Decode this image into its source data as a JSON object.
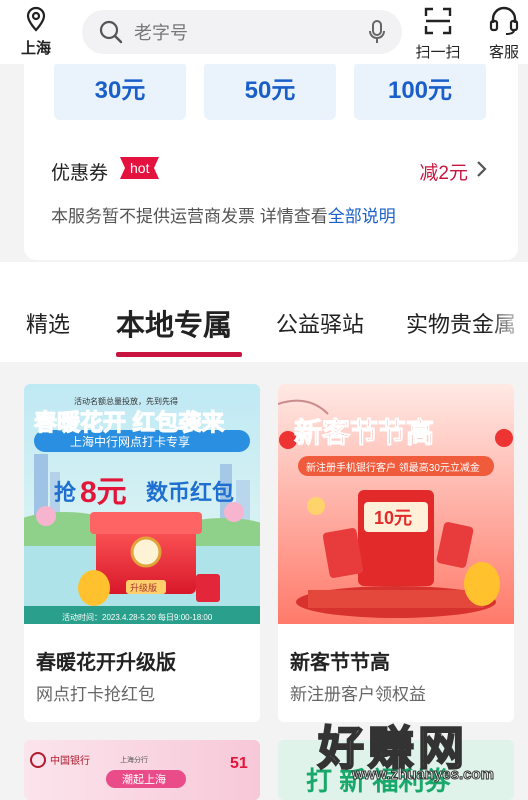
{
  "header": {
    "location": "上海",
    "search_placeholder": "老字号",
    "scan_label": "扫一扫",
    "service_label": "客服"
  },
  "recharge": {
    "amounts": [
      "30元",
      "50元",
      "100元"
    ],
    "coupon_label": "优惠券",
    "hot_badge": "hot",
    "discount": "减2元",
    "notice_prefix": "本服务暂不提供运营商发票 详情查看",
    "notice_link": "全部说明"
  },
  "tabs": [
    "精选",
    "本地专属",
    "公益驿站",
    "实物贵金属"
  ],
  "active_tab": 1,
  "products": [
    {
      "title": "春暖花开升级版",
      "subtitle": "网点打卡抢红包",
      "banner": {
        "headline": "春暖花开 红包袭来",
        "ribbon": "上海中行网点打卡专享",
        "prefix": "抢",
        "amount": "8元",
        "suffix": "数币红包",
        "badge": "升级版",
        "fineprint": "活动名额总量投放，先到先得",
        "period": "活动时间：2023.4.28-5.20 每日9:00-18:00"
      }
    },
    {
      "title": "新客节节高",
      "subtitle": "新注册客户领权益",
      "banner": {
        "headline": "新客节节高",
        "ribbon": "新注册手机银行客户 领最高30元立减金",
        "envelope": "10元"
      }
    }
  ],
  "more_cards": [
    {
      "bank": "中国银行",
      "city_tag": "上海分行",
      "ribbon": "潮起上海",
      "number": "51"
    },
    {
      "text": "打 新 福利券"
    }
  ],
  "watermark": {
    "brand": "好赚网",
    "url": "www.zhuanyes.com"
  },
  "colors": {
    "accent": "#c8153f",
    "link": "#1a5fc9",
    "amount_bg": "#eaf3fb"
  }
}
